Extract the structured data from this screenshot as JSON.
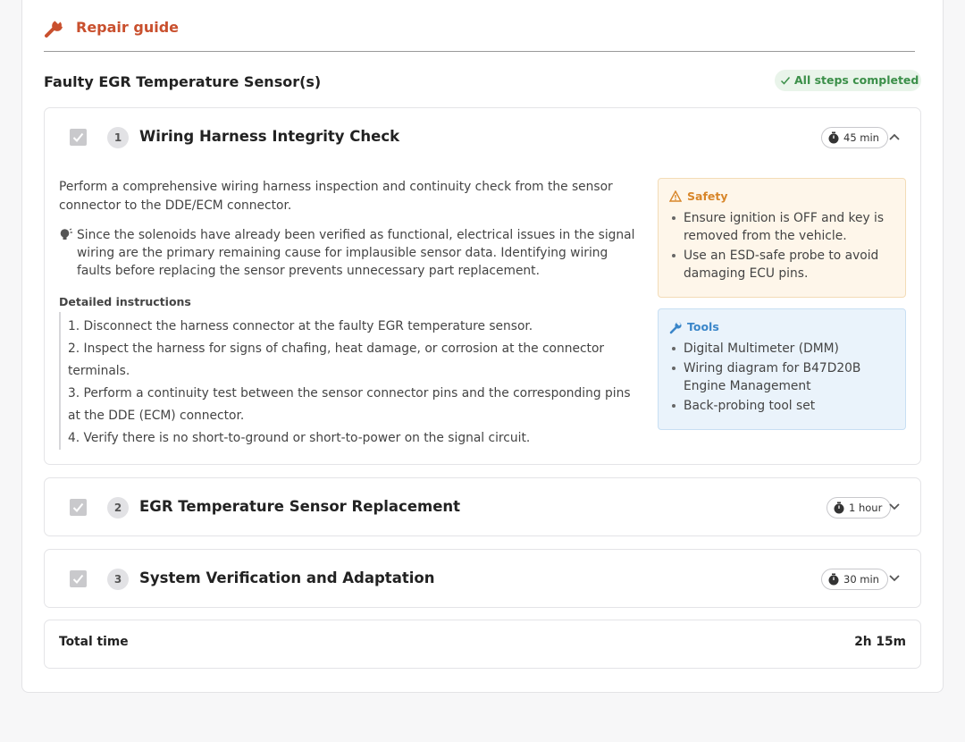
{
  "header": {
    "title": "Repair guide"
  },
  "fault": {
    "title": "Faulty EGR Temperature Sensor(s)",
    "status": "All steps completed"
  },
  "steps": [
    {
      "number": "1",
      "title": "Wiring Harness Integrity Check",
      "time": "45 min",
      "checked": true,
      "expanded": true,
      "description": "Perform a comprehensive wiring harness inspection and continuity check from the sensor connector to the DDE/ECM connector.",
      "tip": "Since the solenoids have already been verified as functional, electrical issues in the signal wiring are the primary remaining cause for implausible sensor data. Identifying wiring faults before replacing the sensor prevents unnecessary part replacement.",
      "detailed_heading": "Detailed instructions",
      "instructions": [
        "1. Disconnect the harness connector at the faulty EGR temperature sensor.",
        "2. Inspect the harness for signs of chafing, heat damage, or corrosion at the connector terminals.",
        "3. Perform a continuity test between the sensor connector pins and the corresponding pins at the DDE (ECM) connector.",
        "4. Verify there is no short-to-ground or short-to-power on the signal circuit."
      ],
      "safety": {
        "title": "Safety",
        "items": [
          "Ensure ignition is OFF and key is removed from the vehicle.",
          "Use an ESD-safe probe to avoid damaging ECU pins."
        ]
      },
      "tools": {
        "title": "Tools",
        "items": [
          "Digital Multimeter (DMM)",
          "Wiring diagram for B47D20B Engine Management",
          "Back-probing tool set"
        ]
      }
    },
    {
      "number": "2",
      "title": "EGR Temperature Sensor Replacement",
      "time": "1 hour",
      "checked": true,
      "expanded": false
    },
    {
      "number": "3",
      "title": "System Verification and Adaptation",
      "time": "30 min",
      "checked": true,
      "expanded": false
    }
  ],
  "total": {
    "label": "Total time",
    "value": "2h 15m"
  },
  "colors": {
    "accent": "#c9502e",
    "success": "#3b8f49",
    "safety": "#d8862a",
    "tools": "#3a86c9"
  },
  "icons": {
    "header": "wrench-icon",
    "status": "check-icon",
    "tip": "lightbulb-icon",
    "safety": "warning-icon",
    "tools": "wrench-icon",
    "time": "stopwatch-icon"
  }
}
